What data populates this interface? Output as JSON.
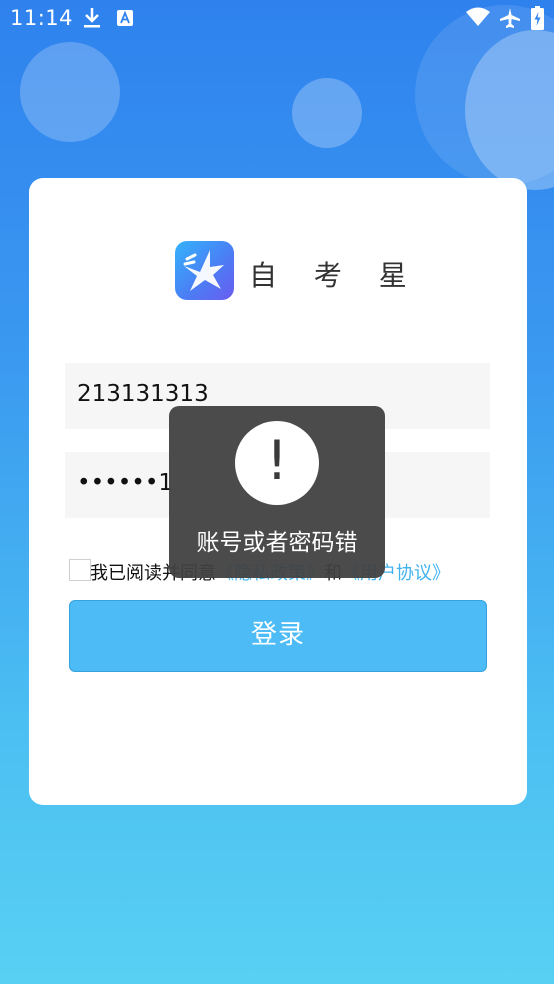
{
  "status_bar": {
    "time": "11:14",
    "icons": [
      "download-icon",
      "a-icon",
      "wifi-icon",
      "airplane-icon",
      "battery-charging-icon"
    ]
  },
  "app": {
    "name": "自 考 星",
    "logo_icon": "star-logo-icon"
  },
  "form": {
    "phone_value": "213131313",
    "password_value": "••••••1"
  },
  "agreement": {
    "prefix": "我已阅读并同意",
    "privacy_link": "《隐私政策》",
    "conjunction": "和",
    "user_link": "《用户协议》"
  },
  "login_button": "登录",
  "toast": {
    "icon_glyph": "!",
    "message": "账号或者密码错"
  },
  "colors": {
    "primary": "#4dbbf6",
    "link": "#41b2ef",
    "background_top": "#2f82ee",
    "background_bottom": "#58d0f3"
  }
}
